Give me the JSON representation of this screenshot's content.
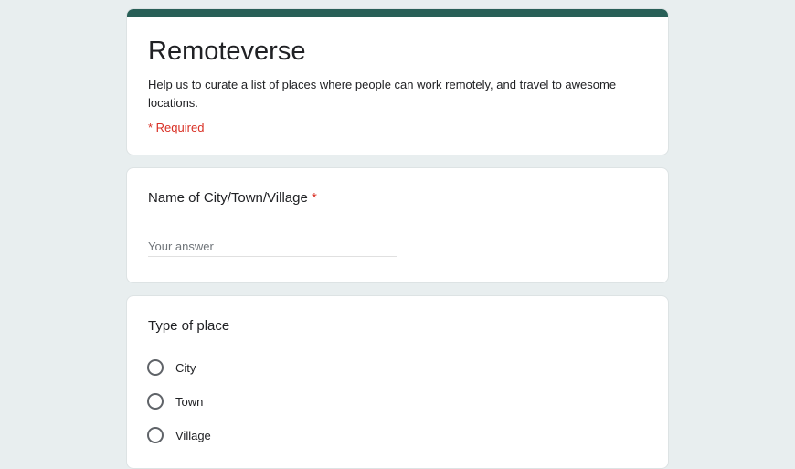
{
  "form": {
    "title": "Remoteverse",
    "description": "Help us to curate a list of places where people can work remotely, and travel to awesome locations.",
    "required_note": "* Required",
    "accent_color": "#285f57"
  },
  "questions": [
    {
      "title": "Name of City/Town/Village",
      "required_mark": "*",
      "type": "short-answer",
      "placeholder": "Your answer",
      "value": ""
    },
    {
      "title": "Type of place",
      "type": "multiple-choice",
      "options": [
        "City",
        "Town",
        "Village"
      ]
    }
  ]
}
